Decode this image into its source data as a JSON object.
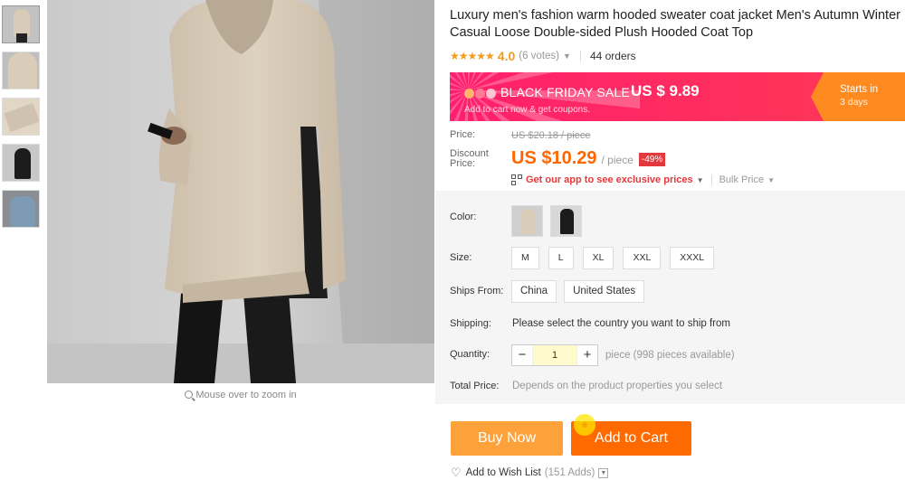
{
  "gallery": {
    "thumbnails": [
      "thumb-1",
      "thumb-2",
      "thumb-3",
      "thumb-4",
      "thumb-5"
    ],
    "zoom_hint": "Mouse over to zoom in"
  },
  "product": {
    "title": "Luxury men's fashion warm hooded sweater coat jacket Men's Autumn Winter Casual Loose Double-sided Plush Hooded Coat Top",
    "stars": "★★★★★",
    "rating": "4.0",
    "votes": "(6 votes)",
    "orders": "44 orders"
  },
  "banner": {
    "headline": "BLACK FRIDAY SALE",
    "price": "US $ 9.89",
    "sub": "Add to cart now & get coupons.",
    "starts": "Starts in",
    "days": "3 days"
  },
  "pricing": {
    "price_label": "Price:",
    "old_price": "US $20.18 / piece",
    "discount_label": "Discount Price:",
    "current_price": "US $10.29",
    "per": "/ piece",
    "discount_badge": "-49%",
    "app_link": "Get our app to see exclusive prices",
    "bulk": "Bulk Price"
  },
  "options": {
    "color_label": "Color:",
    "size_label": "Size:",
    "sizes": [
      "M",
      "L",
      "XL",
      "XXL",
      "XXXL"
    ],
    "ships_label": "Ships From:",
    "ships": [
      "China",
      "United States"
    ],
    "shipping_label": "Shipping:",
    "shipping_msg": "Please select the country you want to ship from",
    "quantity_label": "Quantity:",
    "quantity_minus": "−",
    "quantity_value": "1",
    "quantity_plus": "+",
    "quantity_note": "piece (998 pieces available)",
    "total_label": "Total Price:",
    "total_note": "Depends on the product properties you select"
  },
  "actions": {
    "buy_now": "Buy Now",
    "add_to_cart": "Add to Cart",
    "wish": "Add to Wish List",
    "wish_count": "(151 Adds)"
  },
  "colors": {
    "accent_orange": "#ff6a00",
    "buy_orange": "#fda13b",
    "price_orange": "#ff6600",
    "banner_pink": "#ff1f6e",
    "discount_red": "#e4393c"
  }
}
